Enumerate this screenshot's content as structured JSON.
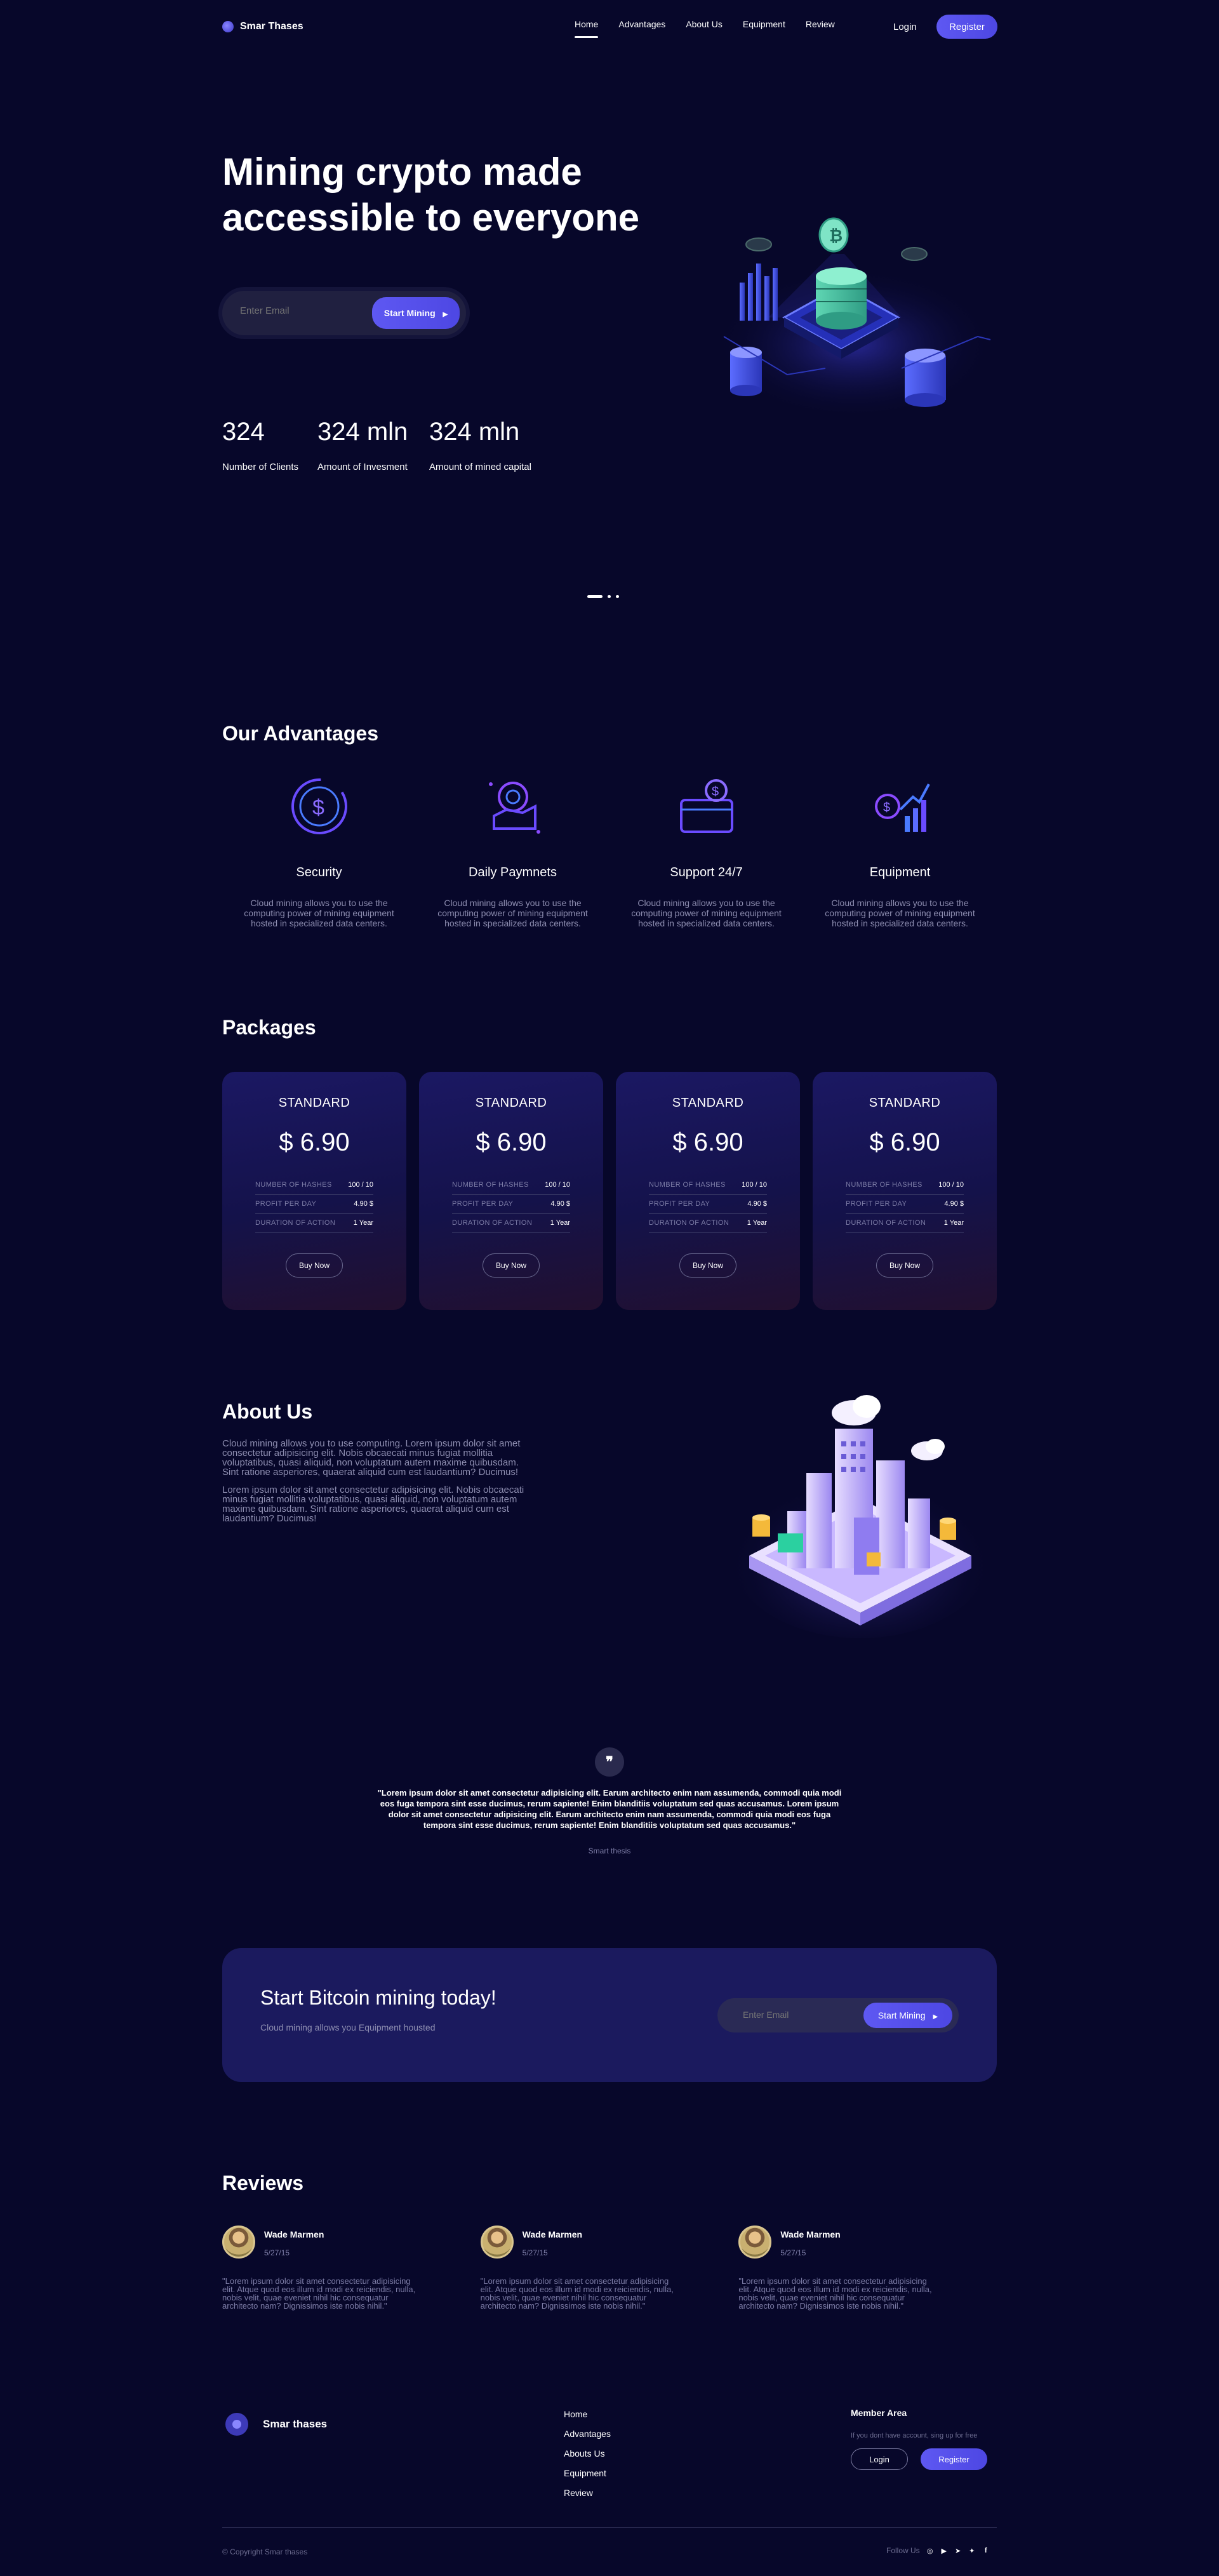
{
  "brand": {
    "name": "Smar Thases"
  },
  "nav": {
    "links": [
      "Home",
      "Advantages",
      "About Us",
      "Equipment",
      "Review"
    ],
    "login": "Login",
    "register": "Register"
  },
  "hero": {
    "title": "Mining crypto made accessible to everyone",
    "email_placeholder": "Enter Email",
    "cta": "Start Mining",
    "stats": [
      {
        "value": "324",
        "label": "Number of Clients"
      },
      {
        "value": "324 mln",
        "label": "Amount of Invesment"
      },
      {
        "value": "324 mln",
        "label": "Amount of mined capital"
      }
    ]
  },
  "advantages": {
    "title": "Our Advantages",
    "items": [
      {
        "icon": "dollar-coin-icon",
        "title": "Security",
        "desc": "Cloud mining allows you to use the computing power of mining equipment hosted in specialized data centers."
      },
      {
        "icon": "payment-hand-icon",
        "title": "Daily Paymnets",
        "desc": "Cloud mining allows you to use the computing power of mining equipment hosted in specialized data centers."
      },
      {
        "icon": "support-wallet-icon",
        "title": "Support 24/7",
        "desc": "Cloud mining allows you to use the computing power of mining equipment hosted in specialized data centers."
      },
      {
        "icon": "growth-chart-icon",
        "title": "Equipment",
        "desc": "Cloud mining allows you to use the computing power of mining equipment hosted in specialized data centers."
      }
    ]
  },
  "packages": {
    "title": "Packages",
    "items": [
      {
        "name": "STANDARD",
        "price": "$ 6.90",
        "rows": [
          [
            "NUMBER OF HASHES",
            "100 / 10"
          ],
          [
            "PROFIT PER DAY",
            "4.90 $"
          ],
          [
            "DURATION OF ACTION",
            "1 Year"
          ]
        ],
        "button": "Buy Now"
      },
      {
        "name": "STANDARD",
        "price": "$ 6.90",
        "rows": [
          [
            "NUMBER OF HASHES",
            "100 / 10"
          ],
          [
            "PROFIT PER DAY",
            "4.90 $"
          ],
          [
            "DURATION OF ACTION",
            "1 Year"
          ]
        ],
        "button": "Buy Now"
      },
      {
        "name": "STANDARD",
        "price": "$ 6.90",
        "rows": [
          [
            "NUMBER OF HASHES",
            "100 / 10"
          ],
          [
            "PROFIT PER DAY",
            "4.90 $"
          ],
          [
            "DURATION OF ACTION",
            "1 Year"
          ]
        ],
        "button": "Buy Now"
      },
      {
        "name": "STANDARD",
        "price": "$ 6.90",
        "rows": [
          [
            "NUMBER OF HASHES",
            "100 / 10"
          ],
          [
            "PROFIT PER DAY",
            "4.90 $"
          ],
          [
            "DURATION OF ACTION",
            "1 Year"
          ]
        ],
        "button": "Buy Now"
      }
    ]
  },
  "about": {
    "title": "About Us",
    "p1": "Cloud mining allows you to use computing. Lorem ipsum dolor sit amet consectetur adipisicing elit. Nobis obcaecati minus fugiat mollitia voluptatibus, quasi aliquid, non voluptatum autem maxime quibusdam. Sint ratione asperiores, quaerat aliquid cum est laudantium? Ducimus!",
    "p2": "Lorem ipsum dolor sit amet consectetur adipisicing elit. Nobis obcaecati minus fugiat mollitia voluptatibus, quasi aliquid, non voluptatum autem maxime quibusdam. Sint ratione asperiores, quaerat aliquid cum est laudantium? Ducimus!"
  },
  "testimonial": {
    "quote_mark": "❞",
    "text": "\"Lorem ipsum dolor sit amet consectetur adipisicing elit. Earum architecto enim nam assumenda, commodi quia modi eos fuga tempora sint esse ducimus, rerum sapiente! Enim blanditiis voluptatum sed quas accusamus. Lorem ipsum dolor sit amet consectetur adipisicing elit. Earum architecto enim nam assumenda, commodi quia modi eos fuga tempora sint esse ducimus, rerum sapiente! Enim blanditiis voluptatum sed quas accusamus.\"",
    "author": "Smart thesis"
  },
  "cta": {
    "title": "Start Bitcoin mining today!",
    "subtitle": "Cloud mining allows you Equipment housted",
    "email_placeholder": "Enter Email",
    "button": "Start Mining"
  },
  "reviews": {
    "title": "Reviews",
    "items": [
      {
        "name": "Wade Marmen",
        "date": "5/27/15",
        "text": "\"Lorem ipsum dolor sit amet consectetur adipisicing elit. Atque quod eos illum id modi ex reiciendis, nulla, nobis velit, quae eveniet nihil hic consequatur architecto nam? Dignissimos iste nobis nihil.\""
      },
      {
        "name": "Wade Marmen",
        "date": "5/27/15",
        "text": "\"Lorem ipsum dolor sit amet consectetur adipisicing elit. Atque quod eos illum id modi ex reiciendis, nulla, nobis velit, quae eveniet nihil hic consequatur architecto nam? Dignissimos iste nobis nihil.\""
      },
      {
        "name": "Wade Marmen",
        "date": "5/27/15",
        "text": "\"Lorem ipsum dolor sit amet consectetur adipisicing elit. Atque quod eos illum id modi ex reiciendis, nulla, nobis velit, quae eveniet nihil hic consequatur architecto nam? Dignissimos iste nobis nihil.\""
      }
    ]
  },
  "footer": {
    "brand": "Smar thases",
    "links": [
      "Home",
      "Advantages",
      "Abouts Us",
      "Equipment",
      "Review"
    ],
    "member_title": "Member Area",
    "member_note": "If you dont have account, sing up for free",
    "login": "Login",
    "register": "Register",
    "copyright": "© Copyright Smar thases",
    "follow": "Follow Us",
    "social_icons": [
      "instagram-icon",
      "youtube-icon",
      "telegram-icon",
      "twitter-icon",
      "facebook-icon"
    ]
  },
  "colors": {
    "background": "#07072a",
    "accent": "#5e58f2",
    "card": "#1b1a5e"
  }
}
